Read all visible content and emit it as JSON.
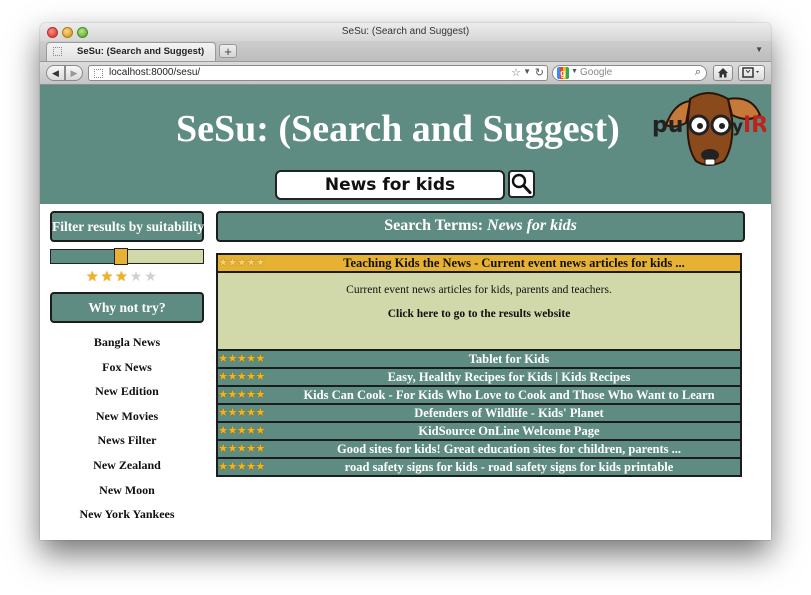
{
  "window": {
    "title": "SeSu: (Search and Suggest)"
  },
  "tabs": [
    {
      "label": "SeSu: (Search and Suggest)"
    }
  ],
  "toolbar": {
    "url": "localhost:8000/sesu/",
    "search_placeholder": "Google",
    "new_tab": "+"
  },
  "header": {
    "title": "SeSu: (Search and Suggest)",
    "logo_text": "PuppyIR",
    "query": "News for kids"
  },
  "sidebar": {
    "filter_label": "Filter results by suitability",
    "suitability_level": 0.44,
    "rating": {
      "value": 3,
      "max": 5
    },
    "why_label": "Why not try?",
    "suggestions": [
      "Bangla News",
      "Fox News",
      "New Edition",
      "New Movies",
      "News Filter",
      "New Zealand",
      "New Moon",
      "New York Yankees"
    ]
  },
  "main": {
    "terms_prefix": "Search Terms:",
    "terms_query": "News for kids",
    "results": [
      {
        "title": "Teaching Kids the News - Current event news articles for kids ...",
        "stars": 5,
        "expanded": true,
        "description": "Current event news articles for kids, parents and teachers.",
        "link_label": "Click here to go to the results website"
      },
      {
        "title": "Tablet for Kids",
        "stars": 5
      },
      {
        "title": "Easy, Healthy Recipes for Kids | Kids Recipes",
        "stars": 5
      },
      {
        "title": "Kids Can Cook - For Kids Who Love to Cook and Those Who Want to Learn",
        "stars": 5
      },
      {
        "title": "Defenders of Wildlife - Kids' Planet",
        "stars": 5
      },
      {
        "title": "KidSource OnLine Welcome Page",
        "stars": 5
      },
      {
        "title": "Good sites for kids! Great education sites for children, parents ...",
        "stars": 5
      },
      {
        "title": "road safety signs for kids - road safety signs for kids printable",
        "stars": 5
      }
    ]
  },
  "colors": {
    "teal": "#5f8c82",
    "gold": "#e7b234",
    "pale_green": "#d1d9aa"
  }
}
